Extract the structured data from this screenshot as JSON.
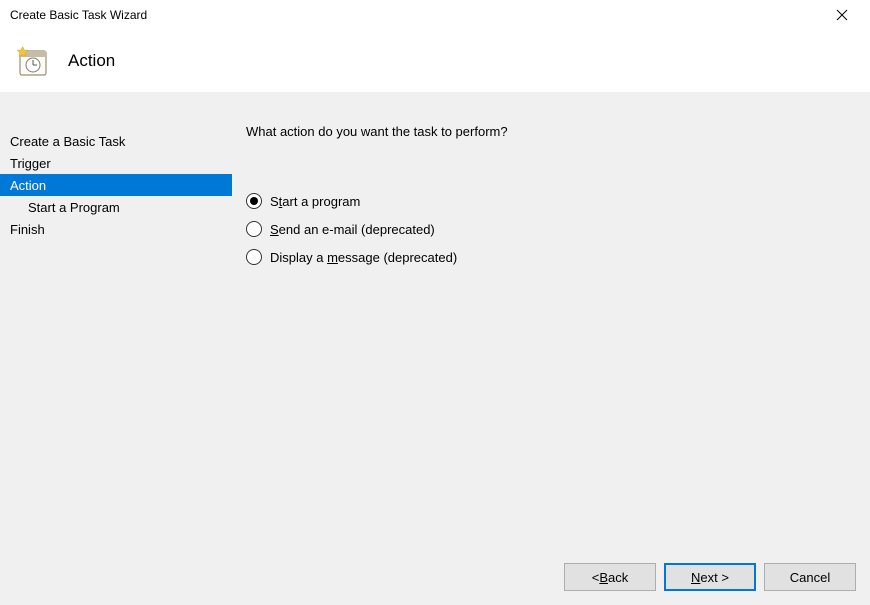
{
  "window": {
    "title": "Create Basic Task Wizard"
  },
  "header": {
    "title": "Action"
  },
  "nav": {
    "items": [
      {
        "label": "Create a Basic Task",
        "indent": false,
        "selected": false
      },
      {
        "label": "Trigger",
        "indent": false,
        "selected": false
      },
      {
        "label": "Action",
        "indent": false,
        "selected": true
      },
      {
        "label": "Start a Program",
        "indent": true,
        "selected": false
      },
      {
        "label": "Finish",
        "indent": false,
        "selected": false
      }
    ]
  },
  "main": {
    "prompt": "What action do you want the task to perform?",
    "options": [
      {
        "pre": "S",
        "mnemonic": "t",
        "post": "art a program",
        "checked": true
      },
      {
        "pre": "",
        "mnemonic": "S",
        "post": "end an e-mail (deprecated)",
        "checked": false
      },
      {
        "pre": "Display a ",
        "mnemonic": "m",
        "post": "essage (deprecated)",
        "checked": false
      }
    ]
  },
  "buttons": {
    "back": {
      "pre": "< ",
      "mnemonic": "B",
      "post": "ack"
    },
    "next": {
      "pre": "",
      "mnemonic": "N",
      "post": "ext >"
    },
    "cancel": "Cancel"
  }
}
